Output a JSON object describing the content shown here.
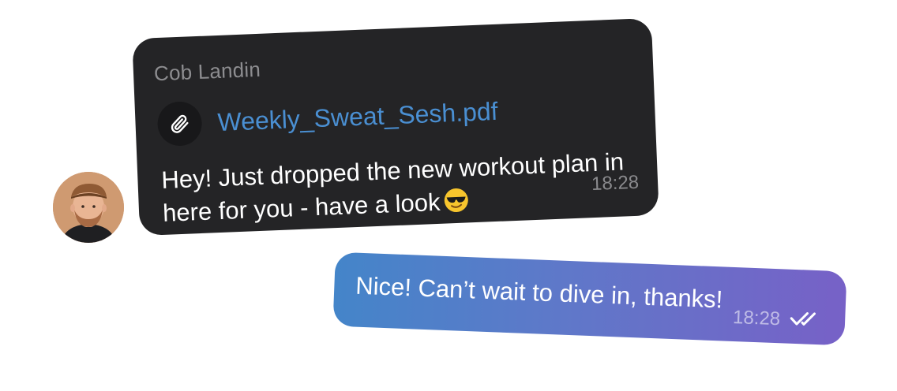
{
  "incoming": {
    "sender": "Cob Landin",
    "attachment": {
      "file_name": "Weekly_Sweat_Sesh.pdf",
      "icon": "paperclip-icon"
    },
    "text": "Hey! Just dropped the new workout plan in here for you - have a look",
    "emoji": "sunglasses-emoji",
    "time": "18:28",
    "avatar": "avatar-cob-landin"
  },
  "outgoing": {
    "text": "Nice! Can’t wait to dive in, thanks!",
    "time": "18:28",
    "status_icon": "double-check-icon"
  },
  "colors": {
    "incoming_bubble": "#242426",
    "link": "#4a8fd2",
    "outgoing_gradient_start": "#4485c9",
    "outgoing_gradient_end": "#7761c7"
  }
}
